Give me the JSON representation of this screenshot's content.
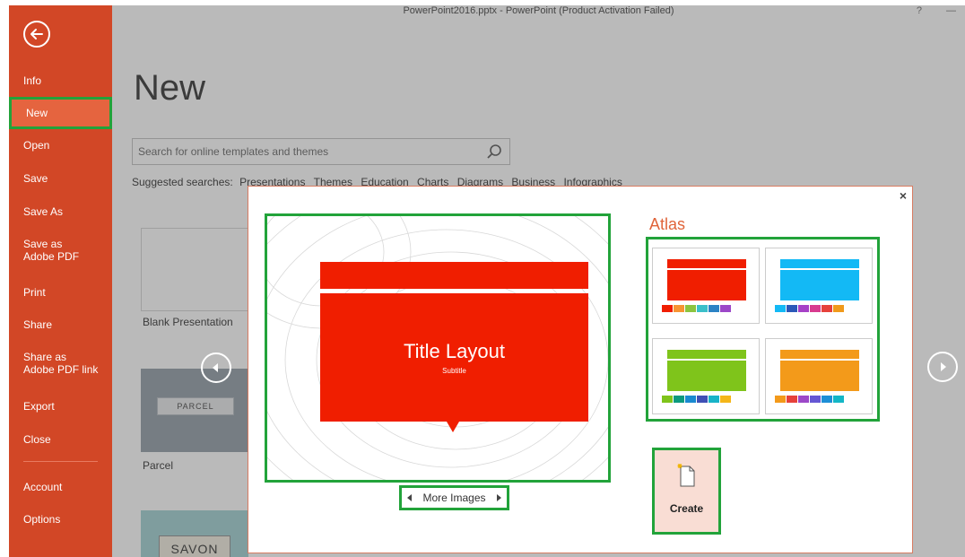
{
  "window": {
    "title": "PowerPoint2016.pptx - PowerPoint (Product Activation Failed)",
    "help": "?",
    "minimize": "—"
  },
  "sidebar": {
    "items": [
      {
        "label": "Info"
      },
      {
        "label": "New"
      },
      {
        "label": "Open"
      },
      {
        "label": "Save"
      },
      {
        "label": "Save As"
      },
      {
        "label": "Save as Adobe PDF"
      },
      {
        "label": "Print"
      },
      {
        "label": "Share"
      },
      {
        "label": "Share as Adobe PDF link"
      },
      {
        "label": "Export"
      },
      {
        "label": "Close"
      },
      {
        "label": "Account"
      },
      {
        "label": "Options"
      }
    ],
    "active": "New"
  },
  "main": {
    "title": "New",
    "search_placeholder": "Search for online templates and themes",
    "suggested_label": "Suggested searches:",
    "suggested": [
      "Presentations",
      "Themes",
      "Education",
      "Charts",
      "Diagrams",
      "Business",
      "Infographics"
    ],
    "tiles": [
      {
        "caption": "Blank Presentation"
      },
      {
        "caption": "Parcel",
        "tag": "PARCEL"
      },
      {
        "caption": "",
        "tag": "SAVON"
      }
    ]
  },
  "dialog": {
    "close": "×",
    "preview_title": "Title Layout",
    "preview_subtitle": "Subtitle",
    "more_images": "More Images",
    "theme_name": "Atlas",
    "create": "Create",
    "variants": [
      {
        "color": "#f01e00",
        "swatches": [
          "#f01e00",
          "#f79433",
          "#8cc43f",
          "#3bbfc9",
          "#2c83c5",
          "#9c48c8"
        ]
      },
      {
        "color": "#13b9f5",
        "swatches": [
          "#13b9f5",
          "#2b58b8",
          "#a641c7",
          "#d83b8f",
          "#e6413b",
          "#f09a1b"
        ]
      },
      {
        "color": "#7fc41b",
        "swatches": [
          "#7fc41b",
          "#0b9a7e",
          "#1a8ad0",
          "#3f50b5",
          "#18b3c8",
          "#f4b619"
        ]
      },
      {
        "color": "#f39a1a",
        "swatches": [
          "#f39a1a",
          "#e6413b",
          "#9c48c8",
          "#6557d4",
          "#1e8fd6",
          "#14b6c6"
        ]
      }
    ],
    "accent": "#e0643a",
    "highlight": "#22a33a"
  }
}
